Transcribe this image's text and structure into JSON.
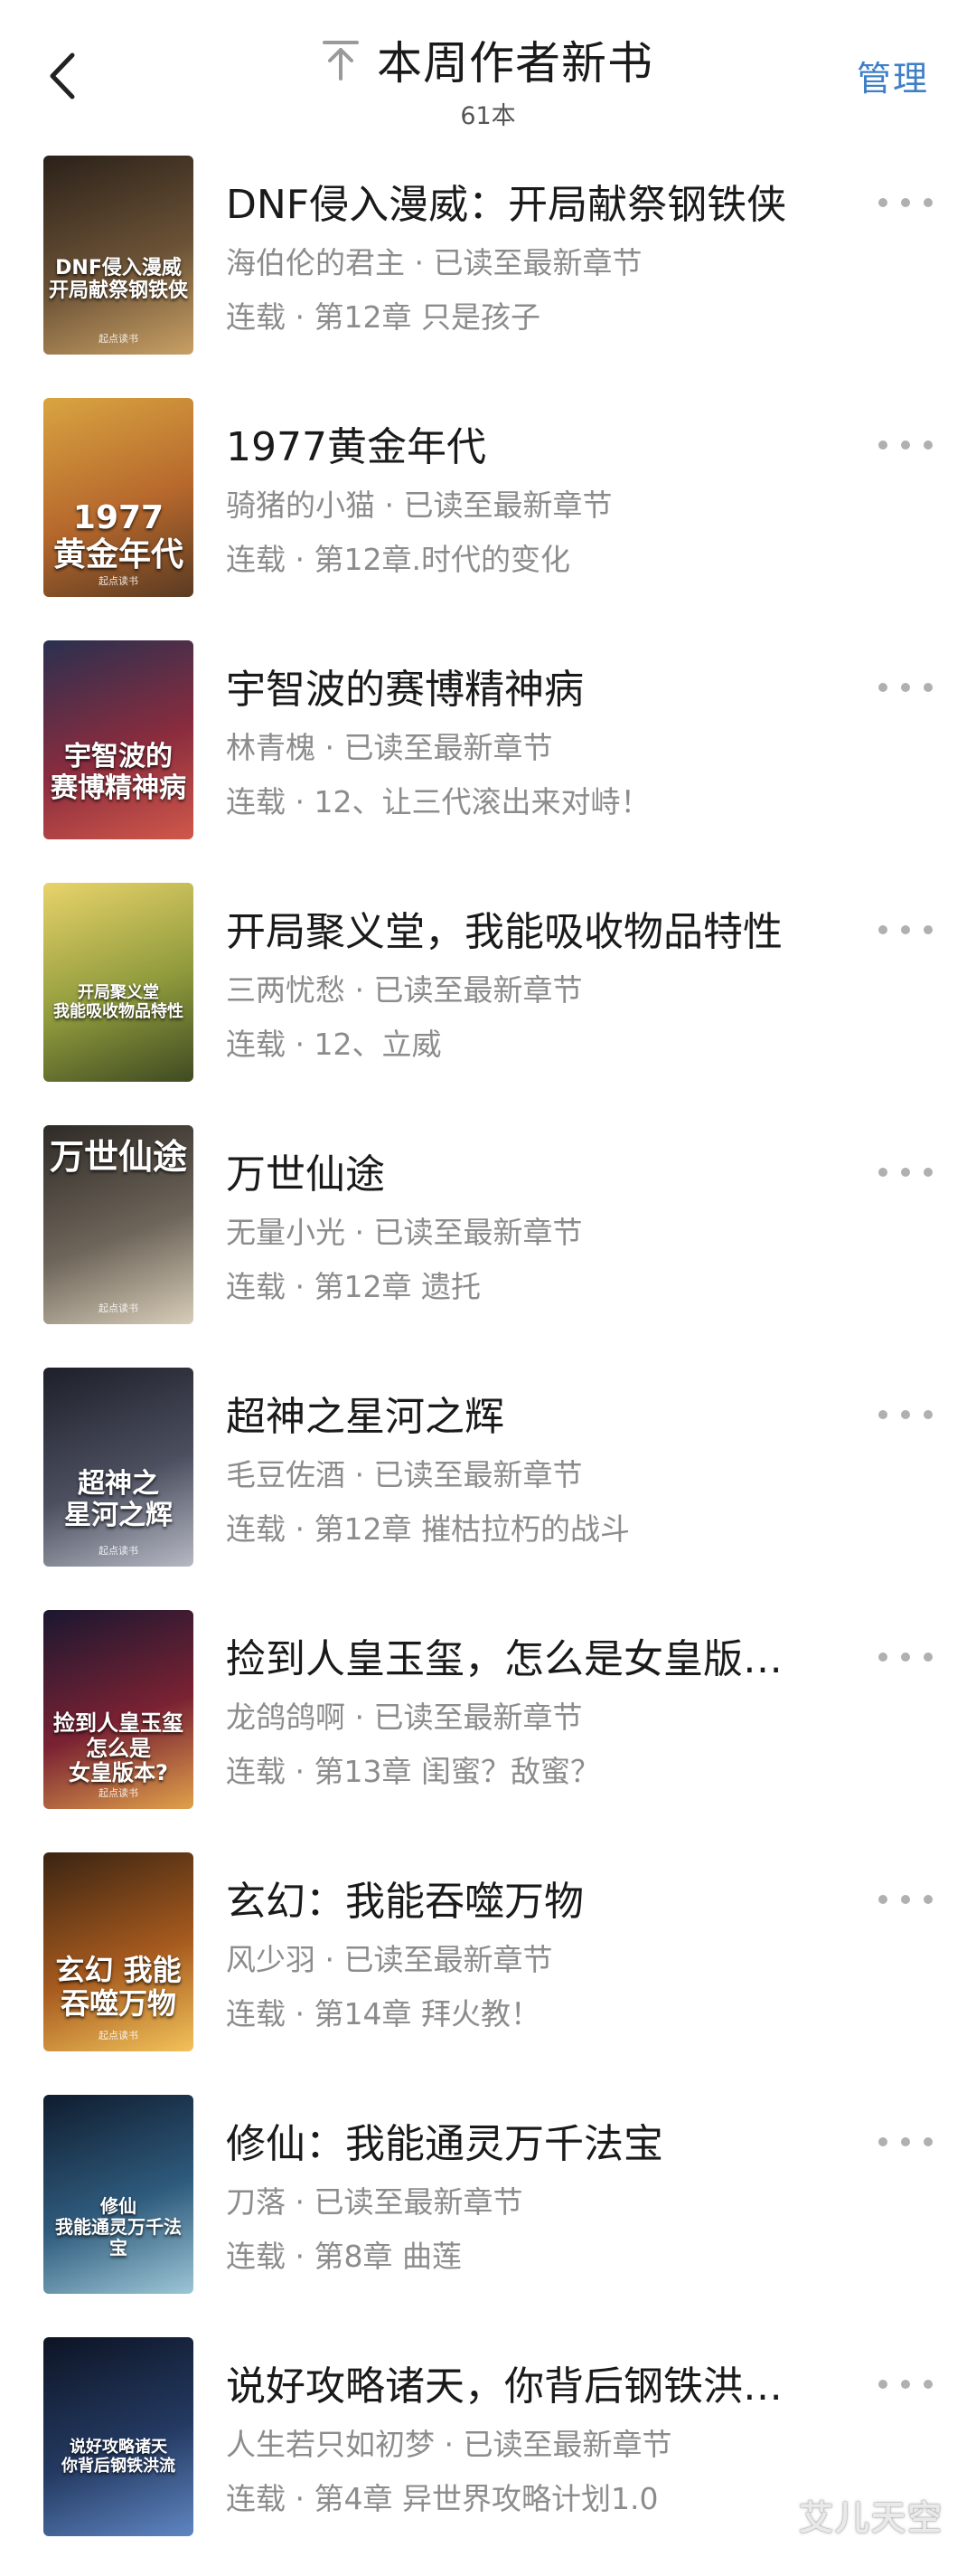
{
  "header": {
    "title": "本周作者新书",
    "count": "61本",
    "manage_label": "管理",
    "back_icon": "chevron-left-icon",
    "pin_icon": "pin-to-top-icon"
  },
  "books": [
    {
      "title": "DNF侵入漫威：开局献祭钢铁侠",
      "author": "海伯伦的君主",
      "status": "已读至最新章节",
      "serial": "连载",
      "chapter": "第12章 只是孩子",
      "cover_text": "DNF侵入漫威\n开局献祭钢铁侠",
      "cover_brand": "起点读书",
      "cover_colors": [
        "#2b2119",
        "#6b5236",
        "#c9a065"
      ]
    },
    {
      "title": "1977黄金年代",
      "author": "骑猪的小猫",
      "status": "已读至最新章节",
      "serial": "连载",
      "chapter": "第12章.时代的变化",
      "cover_text": "1977\n黄金年代",
      "cover_brand": "起点读书",
      "cover_colors": [
        "#d9a441",
        "#b6682c",
        "#5a3a22"
      ]
    },
    {
      "title": "宇智波的赛博精神病",
      "author": "林青槐",
      "status": "已读至最新章节",
      "serial": "连载",
      "chapter": "12、让三代滚出来对峙！",
      "cover_text": "宇智波的\n赛博精神病",
      "cover_brand": "",
      "cover_colors": [
        "#2a3050",
        "#8a2c3e",
        "#d0584a"
      ]
    },
    {
      "title": "开局聚义堂，我能吸收物品特性",
      "author": "三两忧愁",
      "status": "已读至最新章节",
      "serial": "连载",
      "chapter": "12、立威",
      "cover_text": "开局聚义堂\n我能吸收物品特性",
      "cover_brand": "",
      "cover_colors": [
        "#e8d36a",
        "#8f9a3c",
        "#3f4a22"
      ]
    },
    {
      "title": "万世仙途",
      "author": "无量小光",
      "status": "已读至最新章节",
      "serial": "连载",
      "chapter": "第12章 遗托",
      "cover_text": "万世仙途",
      "cover_brand": "起点读书",
      "cover_colors": [
        "#2e2a26",
        "#6e655a",
        "#d8cdb8"
      ]
    },
    {
      "title": "超神之星河之辉",
      "author": "毛豆佐酒",
      "status": "已读至最新章节",
      "serial": "连载",
      "chapter": "第12章 摧枯拉朽的战斗",
      "cover_text": "超神之\n星河之辉",
      "cover_brand": "起点读书",
      "cover_colors": [
        "#1d1f29",
        "#4c4f5f",
        "#b6b9c4"
      ]
    },
    {
      "title": "捡到人皇玉玺，怎么是女皇版…",
      "author": "龙鸽鸽啊",
      "status": "已读至最新章节",
      "serial": "连载",
      "chapter": "第13章 闺蜜？敌蜜？",
      "cover_text": "捡到人皇玉玺\n怎么是\n女皇版本?",
      "cover_brand": "起点读书",
      "cover_colors": [
        "#1a1730",
        "#7a2233",
        "#e0a14a"
      ]
    },
    {
      "title": "玄幻：我能吞噬万物",
      "author": "风少羽",
      "status": "已读至最新章节",
      "serial": "连载",
      "chapter": "第14章 拜火教！",
      "cover_text": "玄幻 我能\n吞噬万物",
      "cover_brand": "起点读书",
      "cover_colors": [
        "#3a2412",
        "#a65a1e",
        "#f2c25a"
      ]
    },
    {
      "title": "修仙：我能通灵万千法宝",
      "author": "刀落",
      "status": "已读至最新章节",
      "serial": "连载",
      "chapter": "第8章 曲莲",
      "cover_text": "修仙\n我能通灵万千法宝",
      "cover_brand": "",
      "cover_colors": [
        "#0f1c2e",
        "#2f5b7d",
        "#9cc6d6"
      ]
    },
    {
      "title": "说好攻略诸天，你背后钢铁洪…",
      "author": "人生若只如初梦",
      "status": "已读至最新章节",
      "serial": "连载",
      "chapter": "第4章 异世界攻略计划1.0",
      "cover_text": "说好攻略诸天\n你背后钢铁洪流",
      "cover_brand": "",
      "cover_colors": [
        "#0d1424",
        "#243a62",
        "#5f86c2"
      ]
    }
  ],
  "watermark": "艾儿天空",
  "more_icon": "more-horizontal-icon"
}
